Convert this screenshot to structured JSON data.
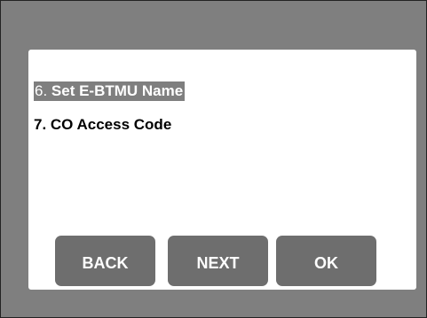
{
  "menu": {
    "items": [
      {
        "number": "6.",
        "label": "Set E-BTMU Name",
        "selected": true
      },
      {
        "number": "7.",
        "label": "CO Access Code",
        "selected": false
      }
    ]
  },
  "buttons": {
    "back_label": "BACK",
    "next_label": "NEXT",
    "ok_label": "OK"
  },
  "colors": {
    "frame": "#7f7f7f",
    "panel": "#ffffff",
    "button": "#6e6e6e",
    "selection_highlight": "#7f7f7f"
  }
}
